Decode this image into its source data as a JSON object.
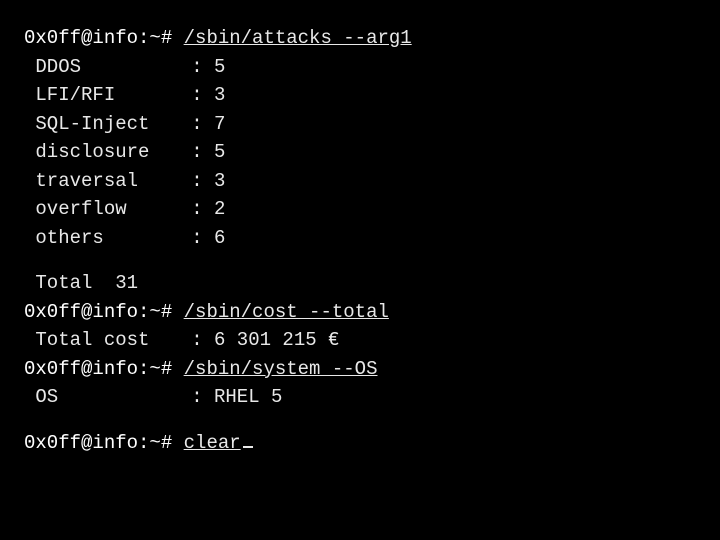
{
  "prompt": "0x0ff@info:~#",
  "commands": {
    "attacks": "/sbin/attacks --arg1",
    "cost": "/sbin/cost --total",
    "system": "/sbin/system --OS",
    "clear": "clear"
  },
  "attacks": {
    "rows": [
      {
        "key": "DDOS",
        "val": "5"
      },
      {
        "key": "LFI/RFI",
        "val": "3"
      },
      {
        "key": "SQL-Inject",
        "val": "7"
      },
      {
        "key": "disclosure",
        "val": "5"
      },
      {
        "key": "traversal",
        "val": "3"
      },
      {
        "key": "overflow",
        "val": "2"
      },
      {
        "key": "others",
        "val": "6"
      }
    ],
    "total_label": "Total",
    "total_value": "31"
  },
  "cost": {
    "label": "Total cost",
    "value": "6 301 215 €"
  },
  "system": {
    "label": "OS",
    "value": "RHEL 5"
  },
  "sep": ":"
}
